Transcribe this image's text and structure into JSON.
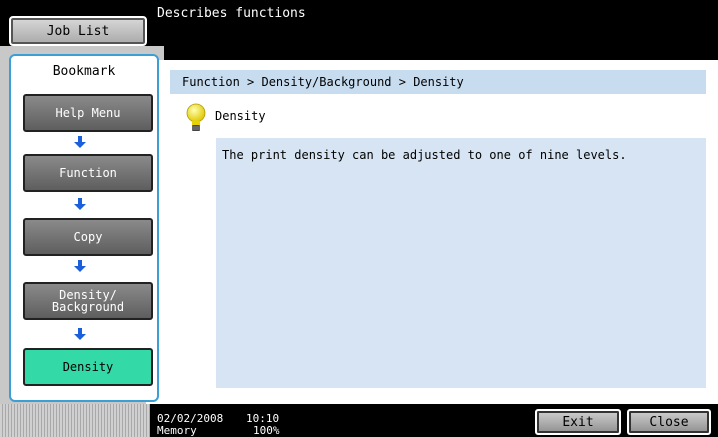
{
  "header": {
    "job_list_label": "Job List",
    "description": "Describes functions"
  },
  "bookmark": {
    "title": "Bookmark",
    "items": [
      {
        "label": "Help Menu"
      },
      {
        "label": "Function"
      },
      {
        "label": "Copy"
      },
      {
        "label": "Density/\nBackground"
      },
      {
        "label": "Density",
        "active": true
      }
    ]
  },
  "main": {
    "breadcrumb": "Function > Density/Background > Density",
    "heading": "Density",
    "body_text": "The print density can be adjusted to one of nine levels."
  },
  "status": {
    "date": "02/02/2008",
    "time": "10:10",
    "memory_label": "Memory",
    "memory_value": "100%"
  },
  "footer": {
    "exit_label": "Exit",
    "close_label": "Close"
  },
  "colors": {
    "active_button": "#33d9a6",
    "arrow": "#1c5fdc",
    "breadcrumb_bg": "#c8dcf0",
    "content_bg": "#d6e4f4"
  }
}
